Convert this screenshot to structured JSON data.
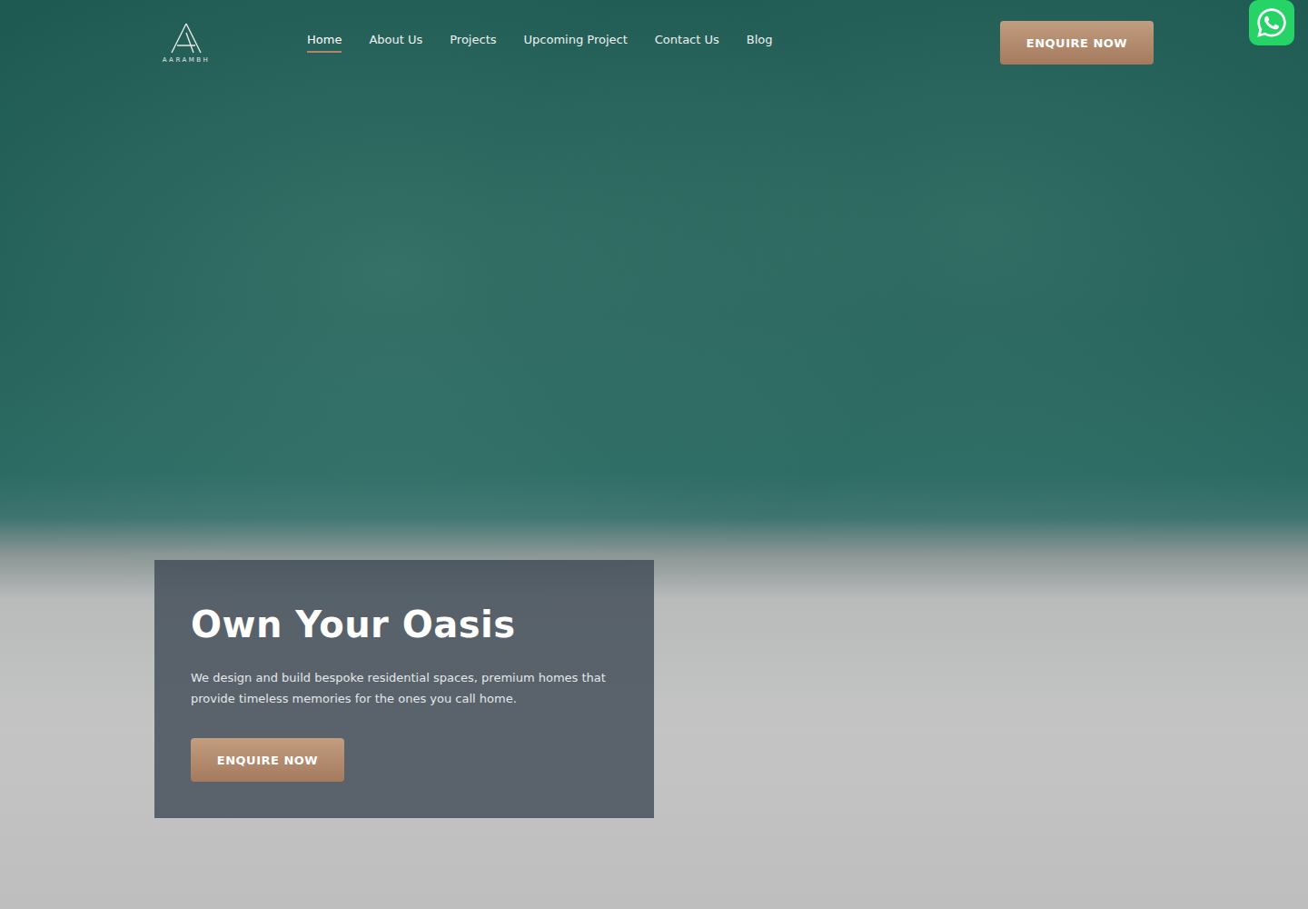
{
  "logo": {
    "text": "AARAMBH"
  },
  "nav": [
    {
      "label": "Home",
      "selected": true
    },
    {
      "label": "About Us",
      "selected": false
    },
    {
      "label": "Projects",
      "selected": false
    },
    {
      "label": "Upcoming Project",
      "selected": false
    },
    {
      "label": "Contact Us",
      "selected": false
    },
    {
      "label": "Blog",
      "selected": false
    }
  ],
  "header_button": "ENQUIRE NOW",
  "hero": {
    "title": "Own Your Oasis",
    "description": "We design and build bespoke residential spaces, premium homes that provide timeless memories for the ones you call home.",
    "button": "ENQUIRE NOW"
  }
}
